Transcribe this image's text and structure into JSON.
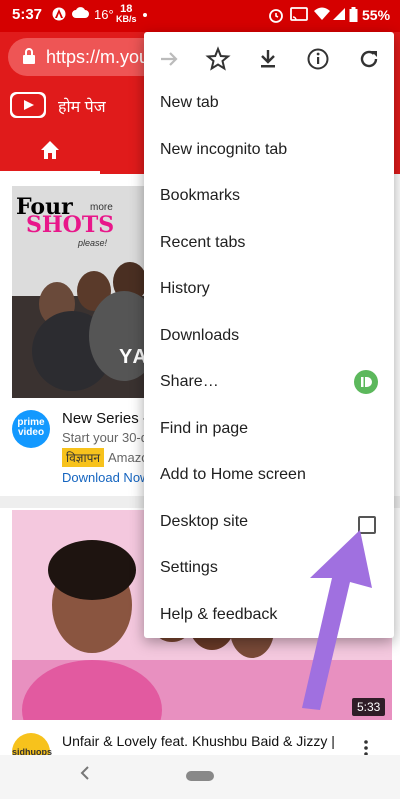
{
  "status_bar": {
    "time": "5:37",
    "temperature": "16°",
    "data_speed_value": "18",
    "data_speed_unit": "KB/s",
    "battery": "55%"
  },
  "url_bar": {
    "url": "https://m.yout"
  },
  "youtube": {
    "header_title": "होम पेज"
  },
  "feed": {
    "video1": {
      "thumb_line1": "Four",
      "thumb_more": "more",
      "thumb_line2": "SHOTS",
      "thumb_please": "please!",
      "thumb_overlay": "YAA",
      "channel_logo_line1": "prime",
      "channel_logo_line2": "video",
      "title": "New Series - F",
      "subtitle": "Start your 30-da",
      "ad_badge": "विज्ञापन",
      "ad_brand": "Amazo",
      "ad_link": "Download Now"
    },
    "video2": {
      "duration": "5:33",
      "channel_logo": "sidhuops",
      "title": "Unfair & Lovely feat. Khushbu Baid & Jizzy |"
    }
  },
  "menu": {
    "items": [
      {
        "label": "New tab"
      },
      {
        "label": "New incognito tab"
      },
      {
        "label": "Bookmarks"
      },
      {
        "label": "Recent tabs"
      },
      {
        "label": "History"
      },
      {
        "label": "Downloads"
      },
      {
        "label": "Share…"
      },
      {
        "label": "Find in page"
      },
      {
        "label": "Add to Home screen"
      },
      {
        "label": "Desktop site"
      },
      {
        "label": "Settings"
      },
      {
        "label": "Help & feedback"
      }
    ],
    "desktop_site_checked": false
  },
  "colors": {
    "youtube_red": "#e01b1b",
    "status_red": "#d50000",
    "arrow_purple": "#a070e0",
    "prime_blue": "#1399ff"
  }
}
